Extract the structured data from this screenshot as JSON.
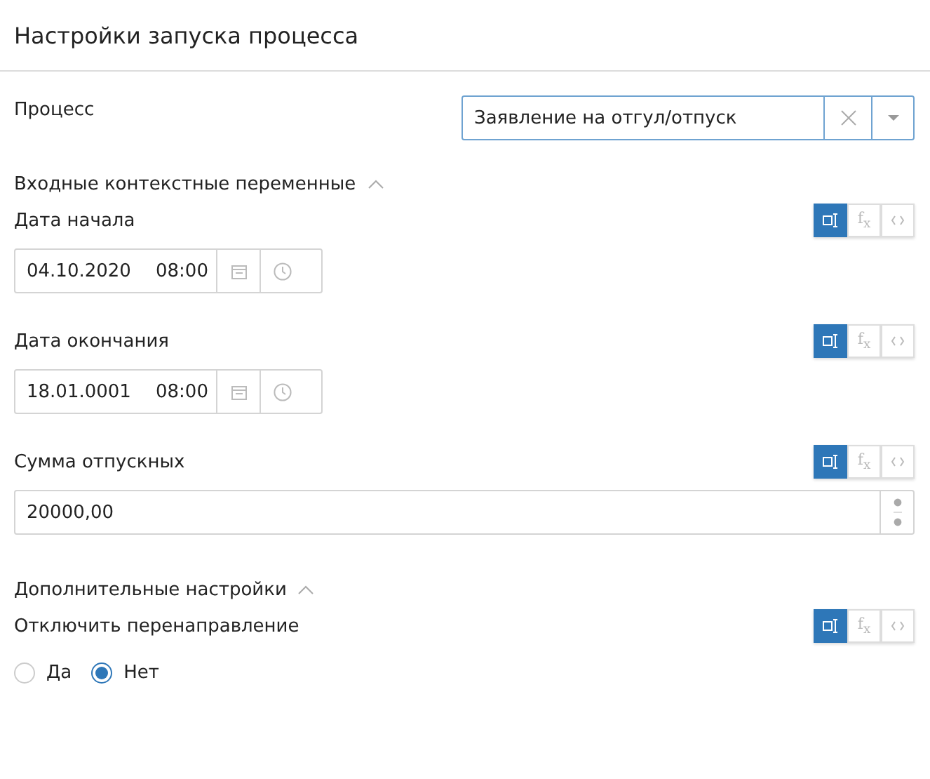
{
  "title": "Настройки запуска процесса",
  "process": {
    "label": "Процесс",
    "value": "Заявление на отгул/отпуск"
  },
  "sections": [
    {
      "title": "Входные контекстные переменные",
      "expanded": true,
      "fields": [
        {
          "kind": "datetime",
          "label": "Дата начала",
          "date": "04.10.2020",
          "time": "08:00",
          "modes": [
            {
              "kind": "input",
              "selected": true
            },
            {
              "kind": "formula",
              "label": "f$_{x}$",
              "selected": false
            },
            {
              "kind": "code",
              "selected": false
            }
          ]
        },
        {
          "kind": "datetime",
          "label": "Дата окончания",
          "date": "18.01.0001",
          "time": "08:00",
          "modes": [
            {
              "kind": "input",
              "selected": true
            },
            {
              "kind": "formula",
              "label": "f$_{x}$",
              "selected": false
            },
            {
              "kind": "code",
              "selected": false
            }
          ]
        },
        {
          "kind": "number",
          "label": "Сумма отпускных",
          "value": "20000,00",
          "modes": [
            {
              "kind": "input",
              "selected": true
            },
            {
              "kind": "formula",
              "label": "f$_{x}$",
              "selected": false
            },
            {
              "kind": "code",
              "selected": false
            }
          ]
        }
      ]
    },
    {
      "title": "Дополнительные настройки",
      "expanded": true,
      "fields": [
        {
          "kind": "radio",
          "label": "Отключить перенаправление",
          "options": [
            {
              "label": "Да",
              "selected": false
            },
            {
              "label": "Нет",
              "selected": true
            }
          ],
          "modes": [
            {
              "kind": "input",
              "selected": true
            },
            {
              "kind": "formula",
              "label": "f$_{x}$",
              "selected": false
            },
            {
              "kind": "code",
              "selected": false
            }
          ]
        }
      ]
    }
  ]
}
